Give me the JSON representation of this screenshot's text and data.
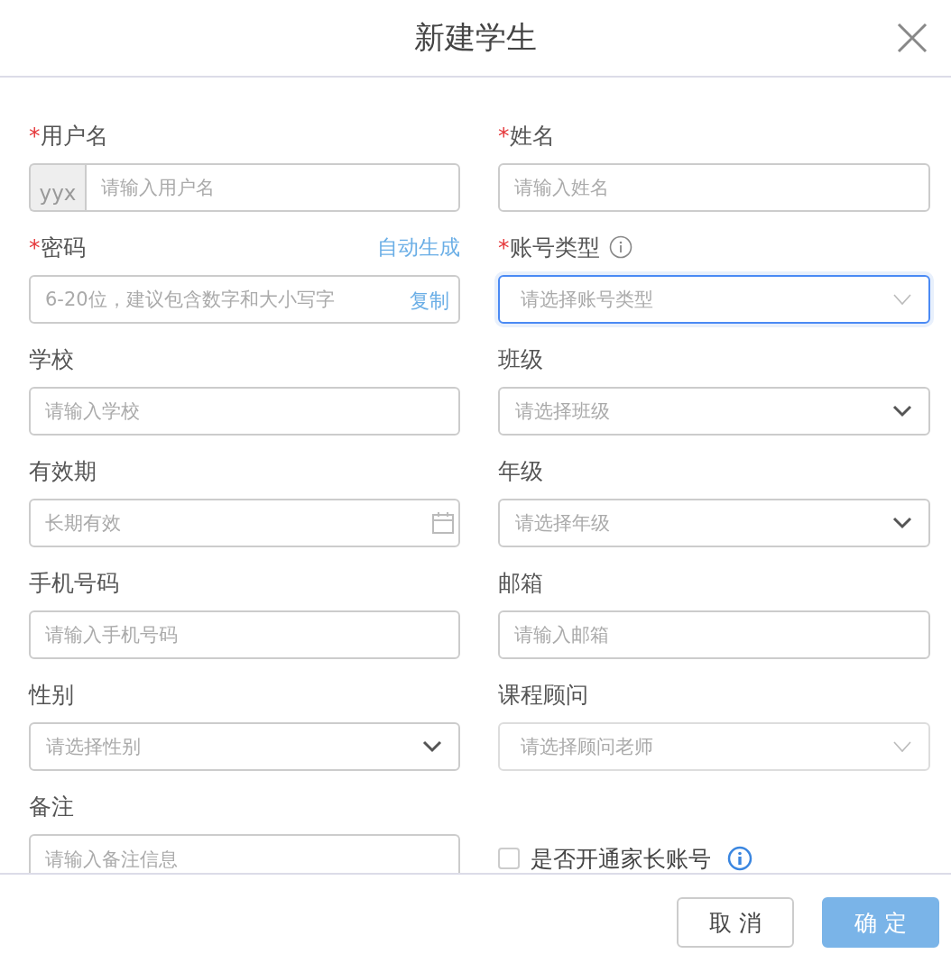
{
  "dialog": {
    "title": "新建学生"
  },
  "fields": [
    {
      "label": "用户名",
      "required_mark": "*",
      "kind": "text",
      "prefix": "yyx",
      "placeholder": "请输入用户名"
    },
    {
      "label": "姓名",
      "required_mark": "*",
      "kind": "text",
      "placeholder": "请输入姓名"
    },
    {
      "label": "密码",
      "required_mark": "*",
      "kind": "password",
      "label_action": "自动生成",
      "suffix_link": "复制",
      "placeholder": "6-20位，建议包含数字和大小写字"
    },
    {
      "label": "账号类型",
      "required_mark": "*",
      "info": true,
      "kind": "picker",
      "focused": true,
      "placeholder": "请选择账号类型"
    },
    {
      "label": "学校",
      "kind": "text",
      "placeholder": "请输入学校"
    },
    {
      "label": "班级",
      "kind": "select",
      "placeholder": "请选择班级"
    },
    {
      "label": "有效期",
      "kind": "date",
      "placeholder": "长期有效"
    },
    {
      "label": "年级",
      "kind": "select",
      "placeholder": "请选择年级"
    },
    {
      "label": "手机号码",
      "kind": "text",
      "placeholder": "请输入手机号码"
    },
    {
      "label": "邮箱",
      "kind": "text",
      "placeholder": "请输入邮箱"
    },
    {
      "label": "性别",
      "kind": "select",
      "placeholder": "请选择性别"
    },
    {
      "label": "课程顾问",
      "kind": "picker",
      "focused": false,
      "placeholder": "请选择顾问老师"
    },
    {
      "label": "备注",
      "kind": "textarea",
      "placeholder": "请输入备注信息"
    },
    {
      "kind": "checkbox",
      "text": "是否开通家长账号",
      "checked": false,
      "info": true
    }
  ],
  "footer": {
    "buttons": [
      {
        "label": "取 消",
        "kind": "secondary"
      },
      {
        "label": "确 定",
        "kind": "primary"
      }
    ]
  }
}
